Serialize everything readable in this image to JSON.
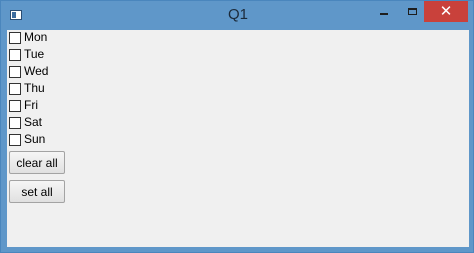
{
  "window": {
    "title": "Q1",
    "close_glyph": "✕"
  },
  "days": [
    {
      "label": "Mon",
      "checked": false
    },
    {
      "label": "Tue",
      "checked": false
    },
    {
      "label": "Wed",
      "checked": false
    },
    {
      "label": "Thu",
      "checked": false
    },
    {
      "label": "Fri",
      "checked": false
    },
    {
      "label": "Sat",
      "checked": false
    },
    {
      "label": "Sun",
      "checked": false
    }
  ],
  "buttons": {
    "clear_all": "clear all",
    "set_all": "set all"
  },
  "colors": {
    "title_bar": "#5f97c9",
    "close_button": "#c9413b",
    "client_bg": "#f0f0f0"
  }
}
